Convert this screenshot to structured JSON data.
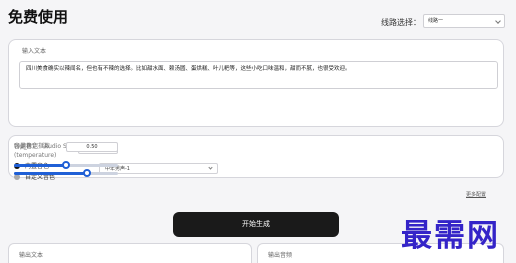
{
  "page": {
    "title": "免费使用"
  },
  "route": {
    "label": "线路选择：",
    "selected": "线路一"
  },
  "input": {
    "label": "输入文本",
    "value": "四川美食确实以辣闻名，但也有不辣的选择。比如甜水面、赖汤圆、蛋烘糕、叶儿粑等，这些小吃口味温和，甜而不腻，也很受欢迎。"
  },
  "voice": {
    "label": "音调音色（Audio Seed）",
    "options": [
      {
        "label": "内置音色",
        "checked": true
      },
      {
        "label": "自定义音色",
        "checked": false
      }
    ],
    "selected": "中年男声-1"
  },
  "temperature": {
    "label": "音量稳定指数(temperature)",
    "value": "0.70",
    "level": 0.7
  },
  "top_p": {
    "label": "top_P",
    "value": "0.50",
    "level": 0.5
  },
  "more_settings": "更多配置",
  "generate_button": "开始生成",
  "output": {
    "text_label": "输出文本",
    "audio_label": "输出音频"
  },
  "watermark": "最需网",
  "colors": {
    "accent": "#1f5fd6",
    "button": "#1a1a1a",
    "watermark": "#3424c8"
  }
}
